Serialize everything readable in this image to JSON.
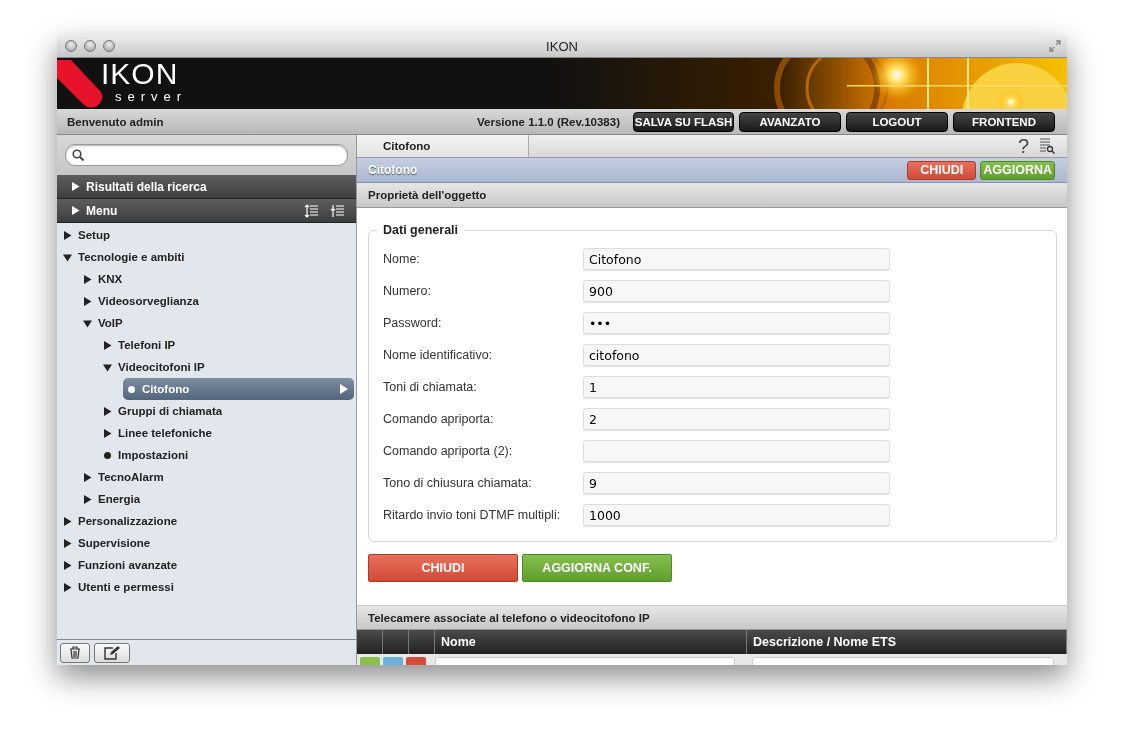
{
  "window": {
    "title": "IKON"
  },
  "logo": {
    "title": "IKON",
    "subtitle": "server"
  },
  "info_bar": {
    "welcome": "Benvenuto admin",
    "version": "Versione 1.1.0 (Rev.10383)",
    "buttons": [
      "SALVA SU FLASH",
      "AVANZATO",
      "LOGOUT",
      "FRONTEND"
    ]
  },
  "sidebar": {
    "sections": [
      {
        "label": "Risultati della ricerca",
        "expanded": false
      },
      {
        "label": "Menu",
        "expanded": false
      }
    ],
    "tree": [
      {
        "label": "Setup",
        "kind": "folder",
        "expanded": false,
        "selected": false
      },
      {
        "label": "Tecnologie e ambiti",
        "kind": "folder",
        "expanded": true,
        "selected": false,
        "children": [
          {
            "label": "KNX",
            "kind": "folder",
            "expanded": false,
            "selected": false
          },
          {
            "label": "Videosorveglianza",
            "kind": "folder",
            "expanded": false,
            "selected": false
          },
          {
            "label": "VoIP",
            "kind": "folder",
            "expanded": true,
            "selected": false,
            "children": [
              {
                "label": "Telefoni IP",
                "kind": "folder",
                "expanded": false,
                "selected": false
              },
              {
                "label": "Videocitofoni IP",
                "kind": "folder",
                "expanded": true,
                "selected": false,
                "children": [
                  {
                    "label": "Citofono",
                    "kind": "leaf",
                    "selected": true
                  }
                ]
              },
              {
                "label": "Gruppi di chiamata",
                "kind": "folder",
                "expanded": false,
                "selected": false
              },
              {
                "label": "Linee telefoniche",
                "kind": "folder",
                "expanded": false,
                "selected": false
              },
              {
                "label": "Impostazioni",
                "kind": "leaf",
                "selected": false
              }
            ]
          },
          {
            "label": "TecnoAlarm",
            "kind": "folder",
            "expanded": false,
            "selected": false
          },
          {
            "label": "Energia",
            "kind": "folder",
            "expanded": false,
            "selected": false
          }
        ]
      },
      {
        "label": "Personalizzazione",
        "kind": "folder",
        "expanded": false,
        "selected": false
      },
      {
        "label": "Supervisione",
        "kind": "folder",
        "expanded": false,
        "selected": false
      },
      {
        "label": "Funzioni avanzate",
        "kind": "folder",
        "expanded": false,
        "selected": false
      },
      {
        "label": "Utenti e permessi",
        "kind": "folder",
        "expanded": false,
        "selected": false
      }
    ]
  },
  "tabs": [
    {
      "label": "Citofono",
      "selected": true
    }
  ],
  "help": "?",
  "object_bar": {
    "title": "Citofono",
    "buttons": [
      {
        "label": "CHIUDI",
        "kind": "close"
      },
      {
        "label": "AGGIORNA",
        "kind": "update"
      }
    ]
  },
  "section_title": "Proprietà dell'oggetto",
  "form": {
    "legend": "Dati generali",
    "fields": [
      {
        "label": "Nome:",
        "value": "Citofono"
      },
      {
        "label": "Numero:",
        "value": "900"
      },
      {
        "label": "Password:",
        "value": "•••"
      },
      {
        "label": "Nome identificativo:",
        "value": "citofono"
      },
      {
        "label": "Toni di chiamata:",
        "value": "1"
      },
      {
        "label": "Comando apriporta:",
        "value": "2"
      },
      {
        "label": "Comando apriporta (2):"
      },
      {
        "label": "Tono di chiusura chiamata:",
        "value": "9"
      },
      {
        "label": "Ritardo invio toni DTMF multipli:",
        "value": "1000"
      }
    ],
    "buttons": [
      {
        "label": "CHIUDI",
        "kind": "close"
      },
      {
        "label": "AGGIORNA CONF.",
        "kind": "update"
      }
    ]
  },
  "cameras": {
    "title": "Telecamere associate al telefono o videocitofono IP",
    "columns": [
      "Nome",
      "Descrizione / Nome ETS"
    ]
  }
}
